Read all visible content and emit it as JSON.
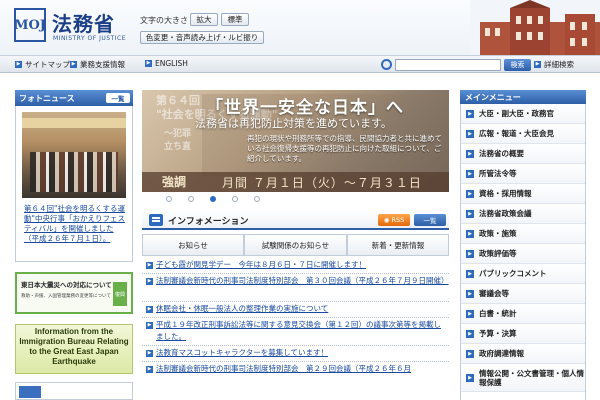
{
  "header": {
    "logo_text": "MOJ",
    "ministry_name": "法務省",
    "ministry_sub": "MINISTRY OF JUSTICE",
    "font_size_label": "文字の大きさ",
    "font_large": "拡大",
    "font_standard": "標準",
    "accessibility": "色変更・音声読み上げ・ルビ振り"
  },
  "nav": {
    "sitemap": "サイトマップ",
    "business": "業務支援情報",
    "english": "ENGLISH",
    "search_placeholder": "",
    "search_button": "検索",
    "detail_search": "詳細検索"
  },
  "photo_news": {
    "title": "フォトニュース",
    "list_button": "一覧",
    "caption": "第６４回\"社会を明るくする運動\"中央行事「おかえりフェスティバル」を開催しました（平成２６年７月１日）。"
  },
  "banners": {
    "eq_title": "東日本大震災への対応について",
    "eq_sub": "救助・声援、入国管理業務の変更等について",
    "eq_badge": "復興",
    "immigration": "Information from the Immigration Bureau Relating to the Great East Japan Earthquake",
    "third": ""
  },
  "carousel": {
    "bg_line1": "第６４回",
    "bg_line2": "\"社会を明るくする運動\"",
    "bg_line3": "～犯罪",
    "bg_line4": "立ち直",
    "title": "「世界一安全な日本」へ",
    "subtitle": "法務省は再犯防止対策を進めています。",
    "body": "再犯の現状や刑務所等での指導、民間協力者と共に進めている社会復帰支援等の再犯防止に向けた取組について、ご紹介しています。",
    "strip_a": "強調",
    "strip_b": "月間 ７月１日（火）～７月３１日（木）",
    "dots": 5,
    "active_dot": 2
  },
  "information": {
    "title": "インフォメーション",
    "rss": "RSS",
    "list_button": "一覧",
    "tabs": [
      "お知らせ",
      "試験関係のお知らせ",
      "新着・更新情報"
    ],
    "items": [
      "子ども霞が関見学デー　今年は８月６日・７日に開催します！",
      "法制審議会新時代の刑事司法制度特別部会　第３０回会議（平成２６年７月９日開催）",
      "休眠会社・休眠一般法人の整理作業の実施について",
      "平成１９年改正刑事訴訟法等に関する意見交換会（第１２回）の議事次第等を掲載しました。",
      "法教育マスコットキャラクターを募集しています！",
      "法制審議会新時代の刑事司法制度特別部会　第２９回会議（平成２６年６月"
    ]
  },
  "main_menu": {
    "title": "メインメニュー",
    "items": [
      "大臣・副大臣・政務官",
      "広報・報道・大臣会見",
      "法務省の概要",
      "所管法令等",
      "資格・採用情報",
      "法務省政策会議",
      "政策・施策",
      "政策評価等",
      "パブリックコメント",
      "審議会等",
      "白書・統計",
      "予算・決算",
      "政府調達情報",
      "情報公開・公文書管理・個人情報保護"
    ]
  },
  "colors": {
    "accent": "#2d5ea7",
    "link": "#1a4ba0",
    "rss": "#e2690b",
    "green": "#69b04a"
  }
}
